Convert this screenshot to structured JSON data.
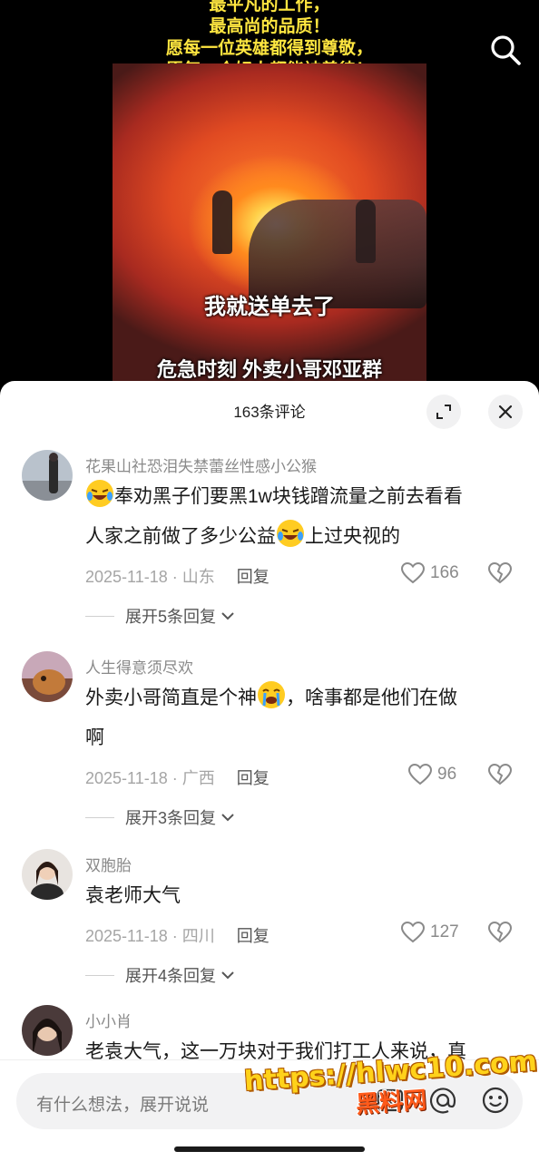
{
  "video": {
    "headline_lines": [
      "最平凡的工作，",
      "最高尚的品质！",
      "愿每一位英雄都得到尊敬，",
      "愿每一个好人都能被善待！"
    ],
    "caption_1": "我就送单去了",
    "caption_2": "危急时刻 外卖小哥邓亚群"
  },
  "sheet": {
    "title": "163条评论"
  },
  "comments": [
    {
      "user": "花果山社恐泪失禁蕾丝性感小公猴",
      "text_line1": "奉劝黑子们要黑1w块钱蹭流量之前去看看",
      "text_line2a": "人家之前做了多少公益",
      "text_line2b": "上过央视的",
      "date": "2025-11-18 · 山东",
      "reply_label": "回复",
      "likes": "166",
      "expand": "展开5条回复"
    },
    {
      "user": "人生得意须尽欢",
      "text_line1": "外卖小哥简直是个神",
      "text_line1b": "，啥事都是他们在做",
      "text_line2": "啊",
      "date": "2025-11-18 · 广西",
      "reply_label": "回复",
      "likes": "96",
      "expand": "展开3条回复"
    },
    {
      "user": "双胞胎",
      "text_line1": "袁老师大气",
      "date": "2025-11-18 · 四川",
      "reply_label": "回复",
      "likes": "127",
      "expand": "展开4条回复"
    },
    {
      "user": "小小肖",
      "text_line1": "老袁大气，这一万块对于我们打工人来说，真"
    }
  ],
  "input": {
    "placeholder": "有什么想法，展开说说"
  },
  "watermark": {
    "url": "https://hlwc10.com",
    "name": "黑料网"
  },
  "colors": {
    "headline": "#ffe640",
    "accent_watermark": "#ffd21a"
  }
}
